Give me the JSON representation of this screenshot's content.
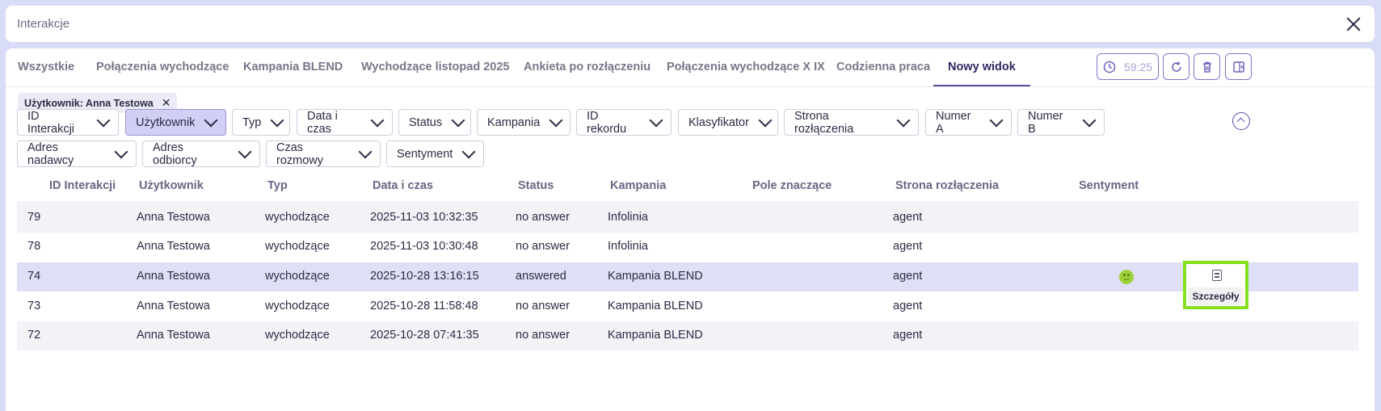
{
  "window": {
    "title": "Interakcje"
  },
  "tabs": [
    {
      "label": "Wszystkie"
    },
    {
      "label": "Połączenia wychodzące"
    },
    {
      "label": "Kampania BLEND"
    },
    {
      "label": "Wychodzące listopad 2025"
    },
    {
      "label": "Ankieta po rozłączeniu"
    },
    {
      "label": "Połączenia wychodzące X IX"
    },
    {
      "label": "Codzienna praca"
    },
    {
      "label": "Nowy widok",
      "active": true
    }
  ],
  "toolbar": {
    "timer": "59:25"
  },
  "active_filter_chip": {
    "label": "Użytkownik: Anna Testowa"
  },
  "filters": [
    {
      "label": "ID Interakcji"
    },
    {
      "label": "Użytkownik",
      "active": true
    },
    {
      "label": "Typ"
    },
    {
      "label": "Data i czas"
    },
    {
      "label": "Status"
    },
    {
      "label": "Kampania"
    },
    {
      "label": "ID rekordu"
    },
    {
      "label": "Klasyfikator"
    },
    {
      "label": "Strona rozłączenia"
    },
    {
      "label": "Numer A"
    },
    {
      "label": "Numer B"
    },
    {
      "label": "Adres nadawcy"
    },
    {
      "label": "Adres odbiorcy"
    },
    {
      "label": "Czas rozmowy"
    },
    {
      "label": "Sentyment"
    }
  ],
  "table": {
    "columns": [
      "ID Interakcji",
      "Użytkownik",
      "Typ",
      "Data i czas",
      "Status",
      "Kampania",
      "Pole znaczące",
      "Strona rozłączenia",
      "Sentyment"
    ],
    "rows": [
      [
        "79",
        "Anna Testowa",
        "wychodzące",
        "2025-11-03 10:32:35",
        "no answer",
        "Infolinia",
        "",
        "agent",
        ""
      ],
      [
        "78",
        "Anna Testowa",
        "wychodzące",
        "2025-11-03 10:30:48",
        "no answer",
        "Infolinia",
        "",
        "agent",
        ""
      ],
      [
        "74",
        "Anna Testowa",
        "wychodzące",
        "2025-10-28 13:16:15",
        "answered",
        "Kampania BLEND",
        "",
        "agent",
        "smiley-positive"
      ],
      [
        "73",
        "Anna Testowa",
        "wychodzące",
        "2025-10-28 11:58:48",
        "no answer",
        "Kampania BLEND",
        "",
        "agent",
        ""
      ],
      [
        "72",
        "Anna Testowa",
        "wychodzące",
        "2025-10-28 07:41:35",
        "no answer",
        "Kampania BLEND",
        "",
        "agent",
        ""
      ]
    ]
  },
  "row_action": {
    "tooltip": "Szczegóły",
    "icon": "document-icon"
  },
  "colors": {
    "accent": "#5a4ea6",
    "highlight_box": "#86e01f",
    "selected_row": "#dfe0f8"
  }
}
